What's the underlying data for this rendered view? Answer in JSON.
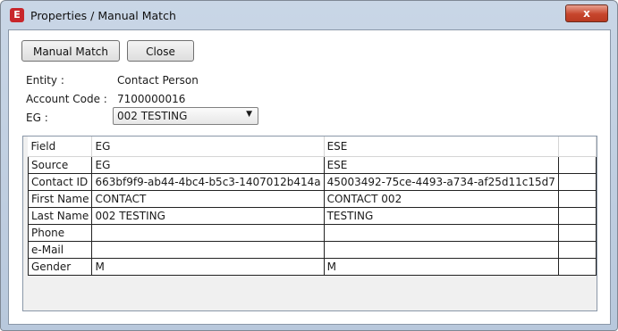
{
  "window": {
    "title": "Properties / Manual Match",
    "icon": "app-e-icon",
    "close_label": "x"
  },
  "toolbar": {
    "manual_match_label": "Manual Match",
    "close_label": "Close"
  },
  "info": {
    "entity_label": "Entity :",
    "entity_value": "Contact Person",
    "account_code_label": "Account Code :",
    "account_code_value": "7100000016",
    "eg_label": "EG :",
    "eg_selected": "002 TESTING"
  },
  "grid": {
    "headers": [
      "Field",
      "EG",
      "ESE",
      ""
    ],
    "rows": [
      [
        "Source",
        "EG",
        "ESE",
        ""
      ],
      [
        "Contact ID",
        "663bf9f9-ab44-4bc4-b5c3-1407012b414a",
        "45003492-75ce-4493-a734-af25d11c15d7",
        ""
      ],
      [
        "First Name",
        "CONTACT",
        "CONTACT 002",
        ""
      ],
      [
        "Last Name",
        "002 TESTING",
        "TESTING",
        ""
      ],
      [
        "Phone",
        "",
        "",
        ""
      ],
      [
        "e-Mail",
        "",
        "",
        ""
      ],
      [
        "Gender",
        "M",
        "M",
        ""
      ]
    ]
  }
}
